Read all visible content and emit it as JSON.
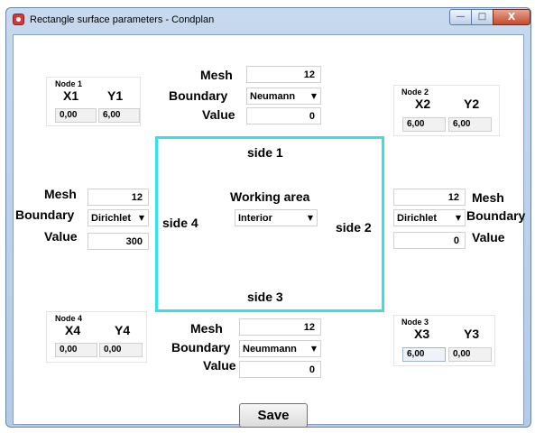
{
  "window": {
    "title": "Rectangle surface parameters - Condplan",
    "minimize_icon": "—",
    "maximize_icon": "□",
    "close_icon": "X"
  },
  "node1": {
    "label": "Node 1",
    "x_label": "X1",
    "y_label": "Y1",
    "x_value": "0,00",
    "y_value": "6,00"
  },
  "node2": {
    "label": "Node 2",
    "x_label": "X2",
    "y_label": "Y2",
    "x_value": "6,00",
    "y_value": "6,00"
  },
  "node3": {
    "label": "Node 3",
    "x_label": "X3",
    "y_label": "Y3",
    "x_value": "6,00",
    "y_value": "0,00"
  },
  "node4": {
    "label": "Node 4",
    "x_label": "X4",
    "y_label": "Y4",
    "x_value": "0,00",
    "y_value": "0,00"
  },
  "side1": {
    "mesh_label": "Mesh",
    "boundary_label": "Boundary",
    "value_label": "Value",
    "mesh": "12",
    "boundary": "Neumann",
    "value": "0",
    "name": "side 1"
  },
  "side2": {
    "mesh_label": "Mesh",
    "boundary_label": "Boundary",
    "value_label": "Value",
    "mesh": "12",
    "boundary": "Dirichlet",
    "value": "0",
    "name": "side 2"
  },
  "side3": {
    "mesh_label": "Mesh",
    "boundary_label": "Boundary",
    "value_label": "Value",
    "mesh": "12",
    "boundary": "Neummann",
    "value": "0",
    "name": "side 3"
  },
  "side4": {
    "mesh_label": "Mesh",
    "boundary_label": "Boundary",
    "value_label": "Value",
    "mesh": "12",
    "boundary": "Dirichlet",
    "value": "300",
    "name": "side 4"
  },
  "working_area": {
    "label": "Working area",
    "region": "Interior"
  },
  "combo_arrow": "▼",
  "save_label": "Save",
  "colors": {
    "working_area_border": "#33e0eb",
    "title_bar": "#c6d9ee",
    "close_button": "#c64a2e"
  }
}
